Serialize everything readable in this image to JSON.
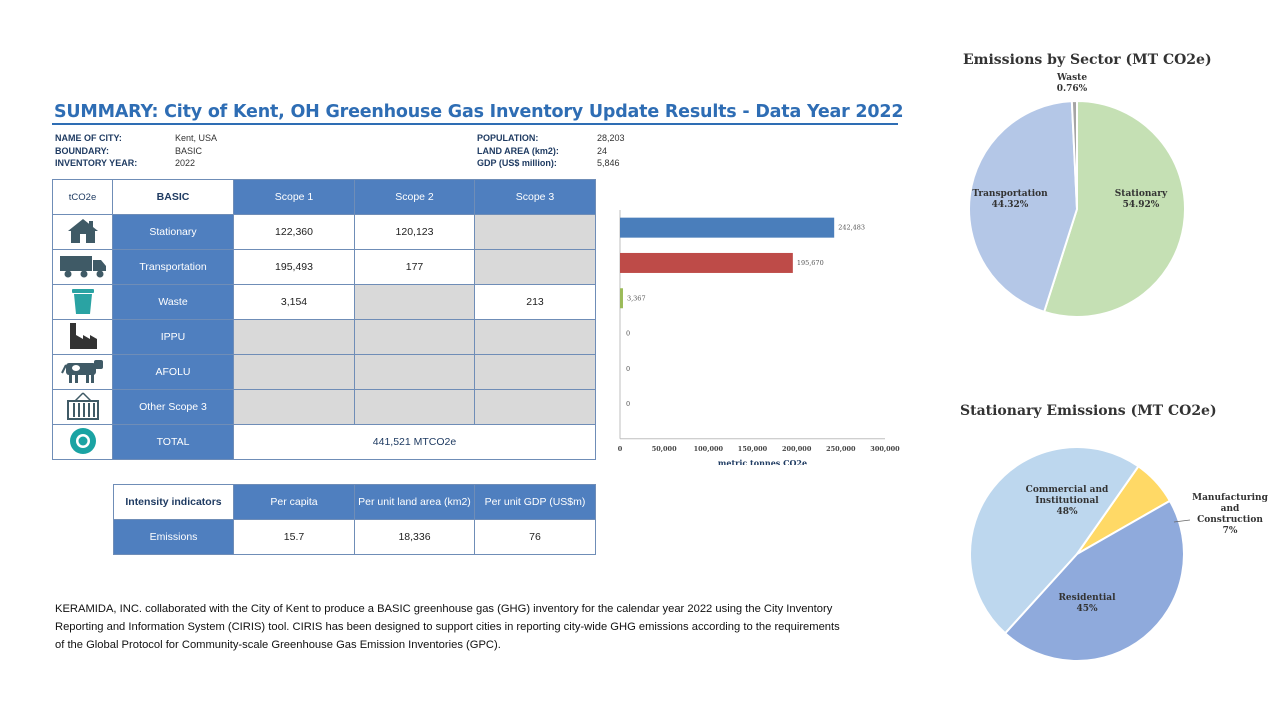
{
  "summary": {
    "title": "SUMMARY: City of Kent, OH Greenhouse Gas Inventory Update Results - Data Year 2022",
    "left_info": [
      {
        "label": "NAME OF CITY:",
        "value": "Kent, USA"
      },
      {
        "label": "BOUNDARY:",
        "value": "BASIC"
      },
      {
        "label": "INVENTORY YEAR:",
        "value": "2022"
      }
    ],
    "right_info": [
      {
        "label": "POPULATION:",
        "value": "28,203"
      },
      {
        "label": "LAND AREA (km2):",
        "value": "24"
      },
      {
        "label": "GDP (US$ million):",
        "value": "5,846"
      }
    ]
  },
  "table": {
    "unit_label": "tCO2e",
    "basic_label": "BASIC",
    "scopes": [
      "Scope 1",
      "Scope 2",
      "Scope 3"
    ],
    "rows": [
      {
        "icon": "house-icon",
        "label": "Stationary",
        "cells": [
          "122,360",
          "120,123",
          null
        ]
      },
      {
        "icon": "truck-icon",
        "label": "Transportation",
        "cells": [
          "195,493",
          "177",
          null
        ]
      },
      {
        "icon": "trash-can-icon",
        "label": "Waste",
        "cells": [
          "3,154",
          null,
          "213"
        ]
      },
      {
        "icon": "factory-icon",
        "label": "IPPU",
        "cells": [
          null,
          null,
          null
        ]
      },
      {
        "icon": "cow-icon",
        "label": "AFOLU",
        "cells": [
          null,
          null,
          null
        ]
      },
      {
        "icon": "shipping-container-icon",
        "label": "Other Scope 3",
        "cells": [
          null,
          null,
          null
        ]
      }
    ],
    "total": {
      "icon": "globe-icon",
      "label": "TOTAL",
      "value": "441,521 MTCO2e"
    }
  },
  "intensity": {
    "header": "Intensity indicators",
    "columns": [
      "Per capita",
      "Per unit land area (km2)",
      "Per unit GDP (US$m)"
    ],
    "row_label": "Emissions",
    "values": [
      "15.7",
      "18,336",
      "76"
    ]
  },
  "footnote": "KERAMIDA, INC. collaborated with the City of Kent to produce a BASIC greenhouse gas (GHG) inventory for the calendar year 2022 using the City Inventory Reporting and Information System (CIRIS) tool. CIRIS has been designed to support cities in reporting city-wide GHG emissions  according to the requirements of the Global Protocol for Community-scale  Greenhouse Gas Emission  Inventories (GPC).",
  "chart_data": [
    {
      "type": "bar",
      "orientation": "horizontal",
      "categories": [
        "Stationary",
        "Transportation",
        "Waste",
        "IPPU",
        "AFOLU",
        "Other Scope 3"
      ],
      "values": [
        242483,
        195670,
        3367,
        0,
        0,
        0
      ],
      "value_labels": [
        "242,483",
        "195,670",
        "3,367",
        "0",
        "0",
        "0"
      ],
      "colors": [
        "#4a7ebb",
        "#be4b48",
        "#9bbb59",
        "#4a7ebb",
        "#4a7ebb",
        "#4a7ebb"
      ],
      "xlim": [
        0,
        300000
      ],
      "x_ticks": [
        "0",
        "50,000",
        "100,000",
        "150,000",
        "200,000",
        "250,000",
        "300,000"
      ],
      "xlabel": "metric tonnes CO2e",
      "grid": false
    },
    {
      "type": "pie",
      "title": "Emissions by Sector (MT CO2e)",
      "slices": [
        {
          "label": "Stationary",
          "value": 54.92,
          "pct_label": "54.92%",
          "color": "#c5e0b4"
        },
        {
          "label": "Transportation",
          "value": 44.32,
          "pct_label": "44.32%",
          "color": "#b4c7e7"
        },
        {
          "label": "Waste",
          "value": 0.76,
          "pct_label": "0.76%",
          "color": "#a5a5a5"
        }
      ]
    },
    {
      "type": "pie",
      "title": "Stationary Emissions (MT CO2e)",
      "slices": [
        {
          "label": "Manufacturing and Construction",
          "value": 7,
          "pct_label": "7%",
          "color": "#ffd966"
        },
        {
          "label": "Residential",
          "value": 45,
          "pct_label": "45%",
          "color": "#8faadc"
        },
        {
          "label": "Commercial and Institutional",
          "value": 48,
          "pct_label": "48%",
          "color": "#bdd7ee"
        }
      ]
    }
  ]
}
